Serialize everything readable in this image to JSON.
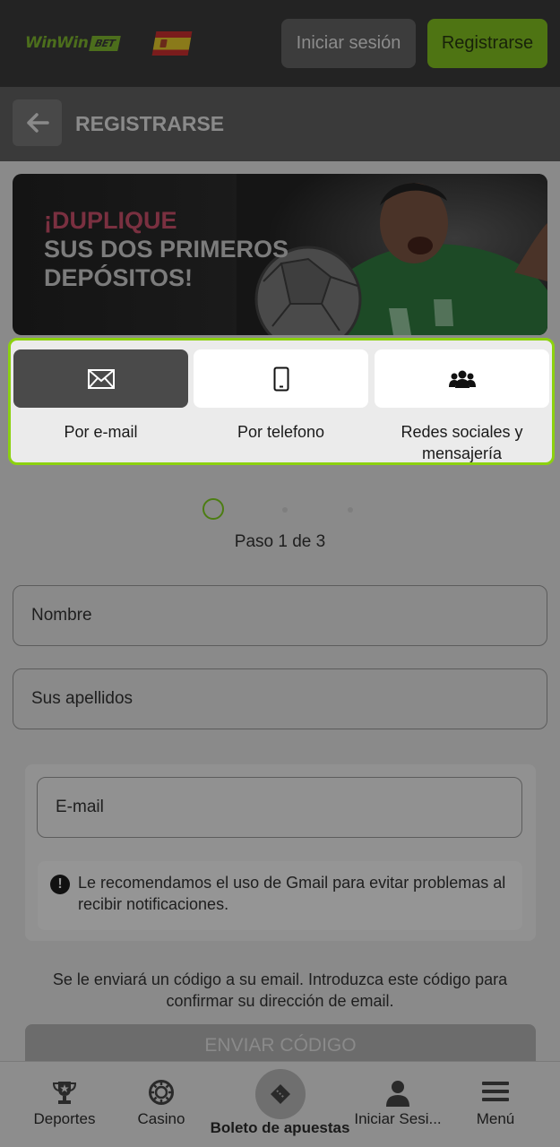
{
  "header": {
    "logo_text": "WinWin",
    "logo_badge": "BET",
    "login_label": "Iniciar sesión",
    "register_label": "Registrarse"
  },
  "subheader": {
    "title": "REGISTRARSE"
  },
  "banner": {
    "line1": "¡DUPLIQUE",
    "line2": "SUS DOS PRIMEROS",
    "line3": "DEPÓSITOS!"
  },
  "methods": [
    {
      "label": "Por e-mail",
      "icon": "envelope-icon",
      "selected": true
    },
    {
      "label": "Por telefono",
      "icon": "phone-icon",
      "selected": false
    },
    {
      "label": "Redes sociales y mensajería",
      "icon": "users-icon",
      "selected": false
    }
  ],
  "steps": {
    "label": "Paso 1 de 3",
    "current": 1,
    "total": 3
  },
  "form": {
    "name_placeholder": "Nombre",
    "surname_placeholder": "Sus apellidos",
    "email_placeholder": "E-mail",
    "notice": "Le recomendamos el uso de Gmail para evitar problemas al recibir notificaciones.",
    "info": "Se le enviará un código a su email. Introduzca este código para confirmar su dirección de email.",
    "send_label": "ENVIAR CÓDIGO"
  },
  "bottom_nav": {
    "sports": "Deportes",
    "casino": "Casino",
    "betslip": "Boleto de apuestas",
    "login": "Iniciar Sesi...",
    "menu": "Menú"
  },
  "colors": {
    "accent": "#8cd10f",
    "register_bg": "#4e7413"
  }
}
